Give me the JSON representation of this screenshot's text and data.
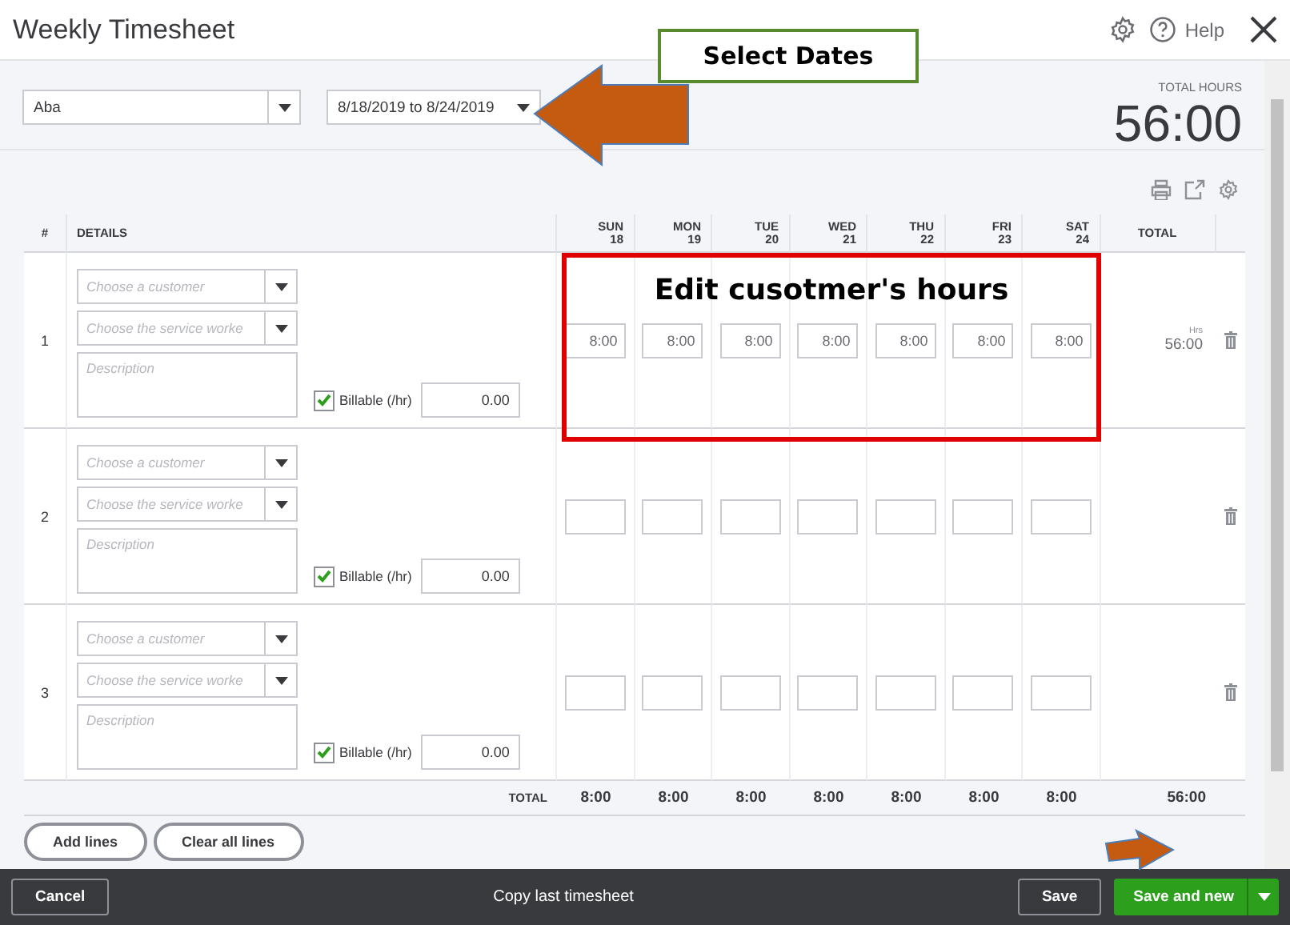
{
  "window": {
    "title": "Weekly Timesheet",
    "help": "Help"
  },
  "employee": {
    "value": "Aba"
  },
  "date_range": {
    "value": "8/18/2019 to 8/24/2019"
  },
  "total_hours": {
    "label": "TOTAL HOURS",
    "value": "56:00"
  },
  "table": {
    "columns": [
      {
        "label": "#"
      },
      {
        "label": "DETAILS"
      },
      {
        "day": "SUN",
        "date": "18"
      },
      {
        "day": "MON",
        "date": "19"
      },
      {
        "day": "TUE",
        "date": "20"
      },
      {
        "day": "WED",
        "date": "21"
      },
      {
        "day": "THU",
        "date": "22"
      },
      {
        "day": "FRI",
        "date": "23"
      },
      {
        "day": "SAT",
        "date": "24"
      },
      {
        "label": "TOTAL"
      }
    ],
    "rows": [
      {
        "number": "1",
        "customer_placeholder": "Choose a customer",
        "service_placeholder": "Choose the service worke",
        "description_placeholder": "Description",
        "billable_label": "Billable (/hr)",
        "billable": true,
        "rate": "0.00",
        "hours": [
          "8:00",
          "8:00",
          "8:00",
          "8:00",
          "8:00",
          "8:00",
          "8:00"
        ],
        "total_unit": "Hrs",
        "total": "56:00"
      },
      {
        "number": "2",
        "customer_placeholder": "Choose a customer",
        "service_placeholder": "Choose the service worke",
        "description_placeholder": "Description",
        "billable_label": "Billable (/hr)",
        "billable": true,
        "rate": "0.00"
      },
      {
        "number": "3",
        "customer_placeholder": "Choose a customer",
        "service_placeholder": "Choose the service worke",
        "description_placeholder": "Description",
        "billable_label": "Billable (/hr)",
        "billable": true,
        "rate": "0.00"
      }
    ],
    "totals": {
      "label": "TOTAL",
      "values": [
        "8:00",
        "8:00",
        "8:00",
        "8:00",
        "8:00",
        "8:00",
        "8:00"
      ],
      "grand_total": "56:00"
    }
  },
  "buttons": [
    {
      "label": "Add lines"
    },
    {
      "label": "Clear all lines"
    }
  ],
  "footer": {
    "cancel": "Cancel",
    "copy": "Copy last timesheet",
    "save": "Save",
    "save_and_new": "Save and new"
  },
  "annotations": [
    {
      "kind": "callout",
      "text": "Select Dates"
    },
    {
      "kind": "frame",
      "text": "Edit cusotmer's hours"
    }
  ]
}
